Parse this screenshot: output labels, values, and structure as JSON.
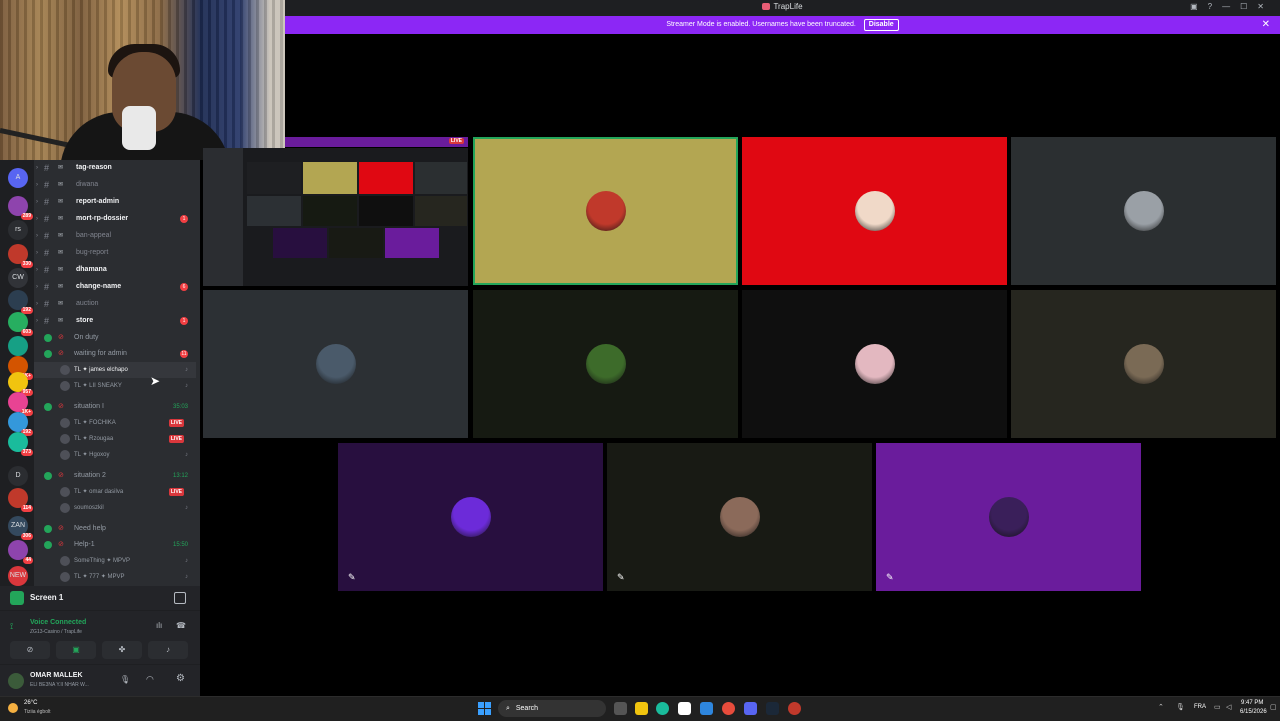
{
  "window": {
    "title": "TrapLife",
    "controls": [
      "▣",
      "?",
      "—",
      "☐",
      "✕"
    ]
  },
  "banner": {
    "text": "Streamer Mode is enabled. Usernames have been truncated.",
    "button": "Disable",
    "close": "✕"
  },
  "guilds": [
    {
      "text": "A",
      "color": "#5865f2",
      "badge": ""
    },
    {
      "text": "",
      "color": "#8e44ad",
      "badge": "289"
    },
    {
      "text": "rs",
      "color": "#2b2d31",
      "badge": ""
    },
    {
      "text": "",
      "color": "#c0392b",
      "badge": "330"
    },
    {
      "text": "CW",
      "color": "#313338",
      "badge": ""
    },
    {
      "text": "",
      "color": "#2c3e50",
      "badge": "192"
    },
    {
      "text": "",
      "color": "#27ae60",
      "badge": "603"
    },
    {
      "text": "",
      "color": "#16a085",
      "badge": ""
    },
    {
      "text": "",
      "color": "#d35400",
      "badge": "1K+"
    },
    {
      "text": "",
      "color": "#f1c40f",
      "badge": "957"
    },
    {
      "text": "",
      "color": "#e84393",
      "badge": "1K+"
    },
    {
      "text": "",
      "color": "#3498db",
      "badge": "192"
    },
    {
      "text": "",
      "color": "#1abc9c",
      "badge": "373"
    },
    {
      "text": "D",
      "color": "#2b2d31",
      "badge": ""
    },
    {
      "text": "",
      "color": "#c0392b",
      "badge": "114"
    },
    {
      "text": "ZAN",
      "color": "#34495e",
      "badge": "306"
    },
    {
      "text": "",
      "color": "#8e44ad",
      "badge": "44"
    },
    {
      "text": "NEW",
      "color": "#da373c",
      "badge": ""
    }
  ],
  "channels": [
    {
      "name": "tag-reason",
      "state": "unread",
      "badge": ""
    },
    {
      "name": "diwana",
      "state": "read",
      "badge": ""
    },
    {
      "name": "report-admin",
      "state": "unread",
      "badge": ""
    },
    {
      "name": "mort-rp-dossier",
      "state": "unread",
      "badge": "1"
    },
    {
      "name": "ban-appeal",
      "state": "read",
      "badge": ""
    },
    {
      "name": "bug-report",
      "state": "read",
      "badge": ""
    },
    {
      "name": "dhamana",
      "state": "unread",
      "badge": ""
    },
    {
      "name": "change-name",
      "state": "unread",
      "badge": "6"
    },
    {
      "name": "auction",
      "state": "read",
      "badge": ""
    },
    {
      "name": "store",
      "state": "unread",
      "badge": "1"
    }
  ],
  "voice": {
    "on_duty": "On duty",
    "waiting": {
      "name": "waiting for admin",
      "badge": "11",
      "users": [
        {
          "name": "TL ✦ james elchapo",
          "highlight": true,
          "live": false
        },
        {
          "name": "TL ✦ LII SNEAKY",
          "highlight": false,
          "live": false
        }
      ]
    },
    "sit1": {
      "name": "situation I",
      "timer": "35:03",
      "users": [
        {
          "name": "TL ✦ FOCHIKA",
          "live": true
        },
        {
          "name": "TL ✦ Rzougaa",
          "live": true
        },
        {
          "name": "TL ✦ Hgoxoy",
          "live": false
        }
      ]
    },
    "sit2": {
      "name": "situation 2",
      "timer": "13:12",
      "users": [
        {
          "name": "TL ✦ omar dasilva",
          "live": true
        },
        {
          "name": "soumoszkil",
          "live": false
        }
      ]
    },
    "need_help": "Need help",
    "help1": {
      "name": "Help-1",
      "timer": "15:50",
      "users": [
        {
          "name": "SomeThing ✦ MPVP",
          "live": false
        },
        {
          "name": "TL ✦ 777 ✦ MPVP",
          "live": false
        }
      ]
    }
  },
  "screen_bar": {
    "label": "Screen 1"
  },
  "voice_status": {
    "title": "Voice Connected",
    "subtitle": "ZG13-Casino / TrapLife"
  },
  "user": {
    "name": "OMAR MALLEK",
    "status": "ELI BE3NA Y.II NHAR W..."
  },
  "stream_live": "LIVE",
  "tiles": [
    {
      "id": "gold",
      "bg": "#b3a652",
      "avatar_color": "#c0392b",
      "selected": true
    },
    {
      "id": "red",
      "bg": "#e00812",
      "avatar_color": "#f0d9c8"
    },
    {
      "id": "gray1",
      "bg": "#2b2f31",
      "avatar_color": "#9aa0a6"
    },
    {
      "id": "gray2",
      "bg": "#2c3034",
      "avatar_color": "#4a5a6a"
    },
    {
      "id": "dkgreen",
      "bg": "#161a12",
      "avatar_color": "#3d6b2a"
    },
    {
      "id": "black",
      "bg": "#0f0f0f",
      "avatar_color": "#e3b8c0"
    },
    {
      "id": "olive",
      "bg": "#26261f",
      "avatar_color": "#7a6a55"
    },
    {
      "id": "purple1",
      "bg": "#280f3f",
      "avatar_color": "#6c2bd9",
      "muted": true
    },
    {
      "id": "dark2",
      "bg": "#181a14",
      "avatar_color": "#8b6a5a",
      "muted": true
    },
    {
      "id": "purple2",
      "bg": "#6a1c9c",
      "avatar_color": "#3a1f5a",
      "muted": true
    }
  ],
  "taskbar": {
    "weather_temp": "26°C",
    "weather_text": "Tiziia égbolt",
    "search": "Search",
    "lang": "FRA",
    "time": "9:47 PM",
    "date": "6/15/2026"
  }
}
